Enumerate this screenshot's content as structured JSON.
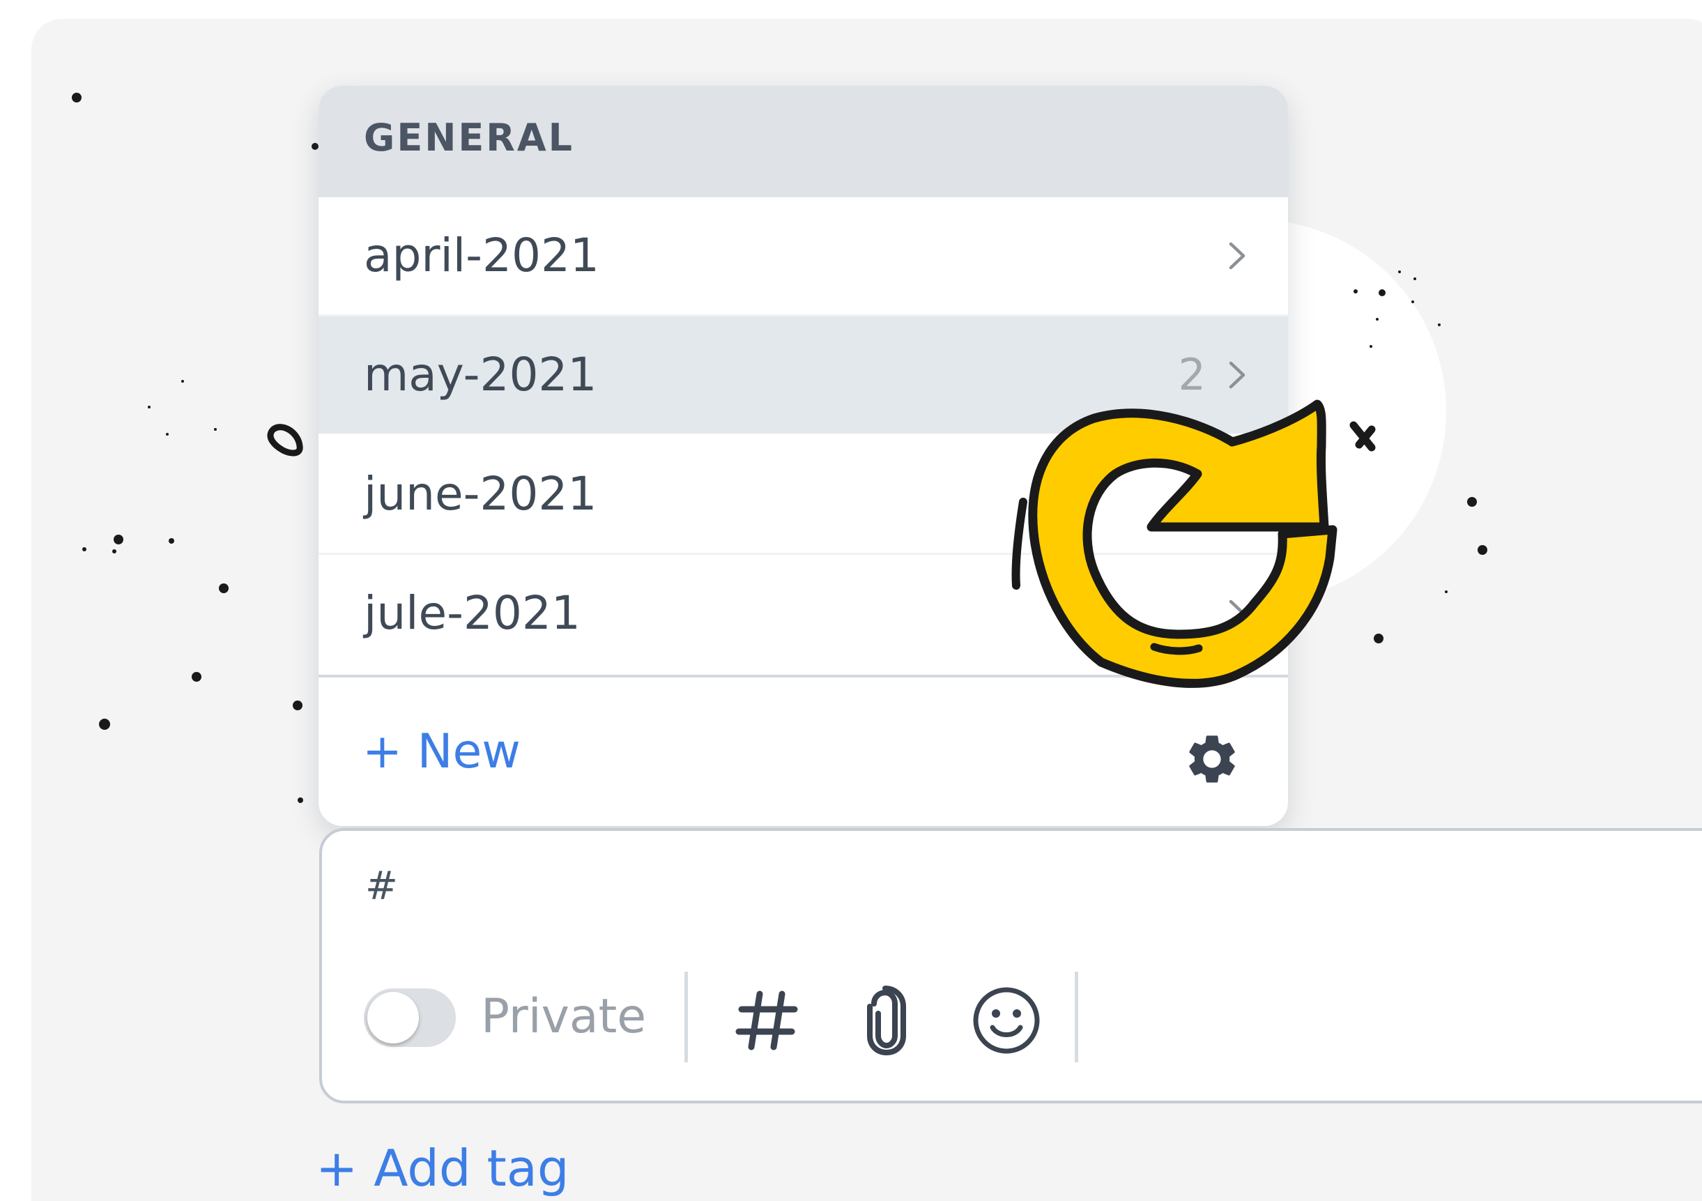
{
  "theme": {
    "accent": "#3d7ee6",
    "header_bg": "#dfe3e7",
    "selected_bg": "#e2e8ec",
    "illustration_yellow": "#ffcc00"
  },
  "dropdown": {
    "section_title": "GENERAL",
    "items": [
      {
        "label": "april-2021",
        "count": "",
        "icon": "chevron-right-icon"
      },
      {
        "label": "may-2021",
        "count": "2",
        "icon": "chevron-right-icon",
        "selected": true
      },
      {
        "label": "june-2021",
        "count": "",
        "icon": "chevron-right-icon"
      },
      {
        "label": "jule-2021",
        "count": "",
        "icon": "chevron-right-icon"
      }
    ],
    "new_label": "+ New",
    "settings_icon": "gear-icon"
  },
  "composer": {
    "input_value": "#",
    "private_label": "Private",
    "private_enabled": false,
    "toolbar_icons": [
      "hashtag-icon",
      "paperclip-icon",
      "smiley-icon"
    ]
  },
  "add_tag_label": "+ Add tag",
  "illustration": "refresh-arrow-icon"
}
